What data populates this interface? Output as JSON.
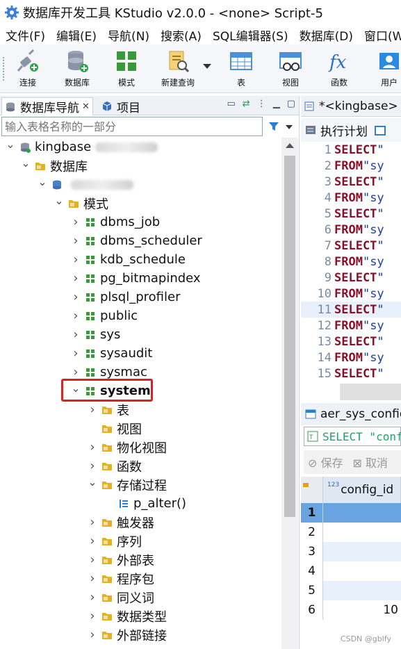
{
  "window": {
    "title": "数据库开发工具 KStudio v2.0.0 - <none> Script-5"
  },
  "menu": [
    "文件(F)",
    "编辑(E)",
    "导航(N)",
    "搜索(A)",
    "SQL编辑器(S)",
    "数据库(D)",
    "窗口(W"
  ],
  "toolbar": {
    "connect": "连接",
    "database": "数据库",
    "schema": "模式",
    "new_query": "新建查询",
    "table": "表",
    "view": "视图",
    "function": "函数",
    "user": "用户"
  },
  "navigator": {
    "tab_db_nav": "数据库导航",
    "tab_close": "✕",
    "tab_project": "项目",
    "search_placeholder": "输入表格名称的一部分"
  },
  "tree": [
    {
      "label": "kingbase",
      "icon": "connection-icon",
      "arrow": "expanded"
    },
    {
      "label": "数据库",
      "icon": "folder-icon",
      "arrow": "expanded"
    },
    {
      "label": "",
      "icon": "database-icon",
      "arrow": "expanded"
    },
    {
      "label": "模式",
      "icon": "folder-icon",
      "arrow": "expanded"
    },
    {
      "label": "dbms_job",
      "icon": "schema-icon",
      "arrow": "collapsed"
    },
    {
      "label": "dbms_scheduler",
      "icon": "schema-icon",
      "arrow": "collapsed"
    },
    {
      "label": "kdb_schedule",
      "icon": "schema-icon",
      "arrow": "collapsed"
    },
    {
      "label": "pg_bitmapindex",
      "icon": "schema-icon",
      "arrow": "collapsed"
    },
    {
      "label": "plsql_profiler",
      "icon": "schema-icon",
      "arrow": "collapsed"
    },
    {
      "label": "public",
      "icon": "schema-icon",
      "arrow": "collapsed"
    },
    {
      "label": "sys",
      "icon": "schema-icon",
      "arrow": "collapsed"
    },
    {
      "label": "sysaudit",
      "icon": "schema-icon",
      "arrow": "collapsed"
    },
    {
      "label": "sysmac",
      "icon": "schema-icon",
      "arrow": "collapsed"
    },
    {
      "label": "system",
      "icon": "schema-icon",
      "arrow": "expanded",
      "bold": true
    },
    {
      "label": "表",
      "icon": "folder-icon",
      "arrow": "collapsed"
    },
    {
      "label": "视图",
      "icon": "folder-icon",
      "arrow": "none"
    },
    {
      "label": "物化视图",
      "icon": "folder-icon",
      "arrow": "collapsed"
    },
    {
      "label": "函数",
      "icon": "folder-icon",
      "arrow": "collapsed"
    },
    {
      "label": "存储过程",
      "icon": "folder-icon",
      "arrow": "expanded"
    },
    {
      "label": "p_alter()",
      "icon": "procedure-icon",
      "arrow": "none"
    },
    {
      "label": "触发器",
      "icon": "folder-icon",
      "arrow": "collapsed"
    },
    {
      "label": "序列",
      "icon": "folder-icon",
      "arrow": "collapsed"
    },
    {
      "label": "外部表",
      "icon": "folder-icon",
      "arrow": "collapsed"
    },
    {
      "label": "程序包",
      "icon": "folder-icon",
      "arrow": "collapsed"
    },
    {
      "label": "同义词",
      "icon": "folder-icon",
      "arrow": "collapsed"
    },
    {
      "label": "数据类型",
      "icon": "folder-icon",
      "arrow": "collapsed"
    },
    {
      "label": "外部链接",
      "icon": "folder-icon",
      "arrow": "collapsed"
    }
  ],
  "editor": {
    "tab_title": "*<kingbase>",
    "toolbar_exec_plan": "执行计划",
    "lines": [
      {
        "num": "1",
        "kw": "SELECT",
        "rest": " \""
      },
      {
        "num": "2",
        "kw": "FROM",
        "rest": " \"sy"
      },
      {
        "num": "3",
        "kw": "SELECT",
        "rest": " \""
      },
      {
        "num": "4",
        "kw": "FROM",
        "rest": " \"sy"
      },
      {
        "num": "5",
        "kw": "SELECT",
        "rest": " \""
      },
      {
        "num": "6",
        "kw": "FROM",
        "rest": " \"sy"
      },
      {
        "num": "7",
        "kw": "SELECT",
        "rest": " \""
      },
      {
        "num": "8",
        "kw": "FROM",
        "rest": " \"sy"
      },
      {
        "num": "9",
        "kw": "SELECT",
        "rest": " \""
      },
      {
        "num": "10",
        "kw": "FROM",
        "rest": " \"sy"
      },
      {
        "num": "11",
        "kw": "SELECT",
        "rest": " \""
      },
      {
        "num": "12",
        "kw": "FROM",
        "rest": " \"sy"
      },
      {
        "num": "13",
        "kw": "SELECT",
        "rest": " \""
      },
      {
        "num": "14",
        "kw": "FROM",
        "rest": " \"sy"
      },
      {
        "num": "15",
        "kw": "SELECT",
        "rest": " \""
      }
    ]
  },
  "result": {
    "tab_title": "aer_sys_config",
    "sql_text": "SELECT \"config",
    "save": "保存",
    "cancel": "取消",
    "column": "config_id",
    "column_type": "123",
    "rows": [
      {
        "num": "1",
        "value": ""
      },
      {
        "num": "2",
        "value": ""
      },
      {
        "num": "3",
        "value": ""
      },
      {
        "num": "4",
        "value": ""
      },
      {
        "num": "5",
        "value": ""
      },
      {
        "num": "6",
        "value": "10"
      }
    ]
  },
  "watermark": "CSDN @gblfy",
  "colors": {
    "highlight": "#e02020",
    "selected_row": "#6aa4e0",
    "keyword": "#8b0f2a",
    "schema_icon": "#3a9a3a",
    "folder_icon": "#e6b020"
  }
}
